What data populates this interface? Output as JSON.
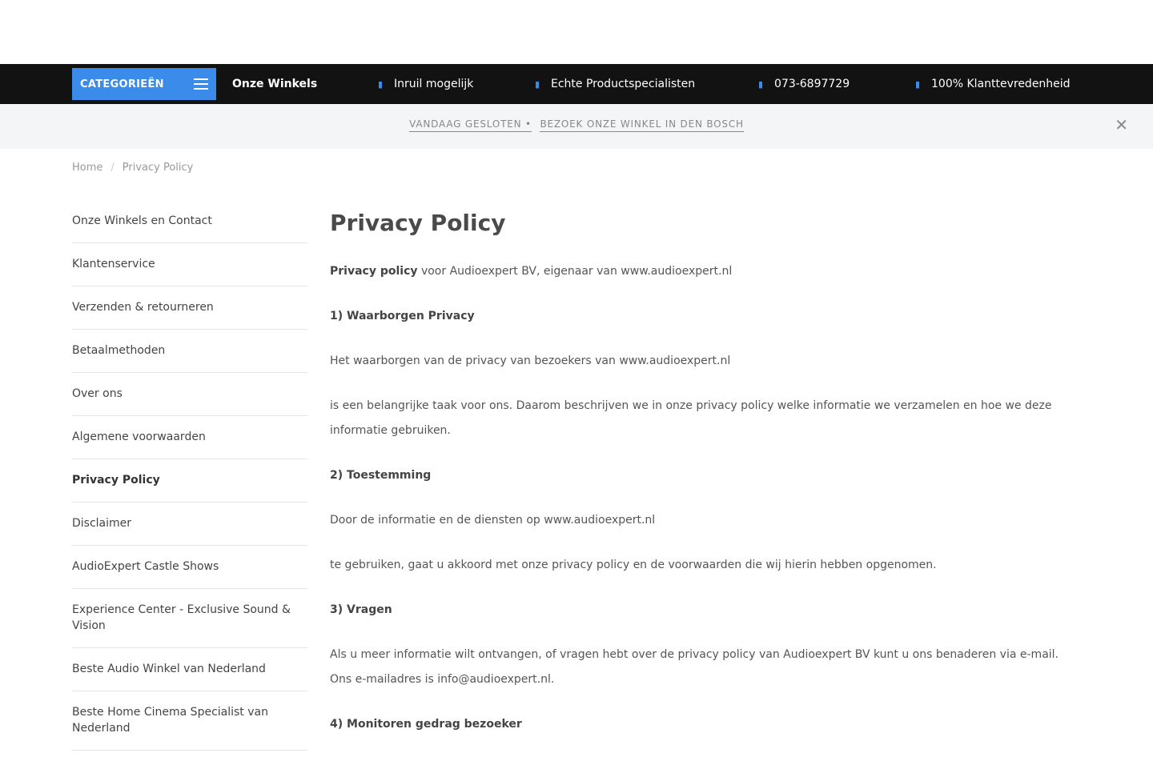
{
  "navbar": {
    "categories_label": "CATEGORIEËN",
    "stores_link": "Onze Winkels",
    "usps": [
      {
        "icon": "check-icon",
        "label": "Inruil mogelijk"
      },
      {
        "icon": "check-icon",
        "label": "Echte Productspecialisten"
      },
      {
        "icon": "phone-icon",
        "label": "073-6897729"
      },
      {
        "icon": "check-icon",
        "label": "100% Klanttevredenheid"
      }
    ],
    "accent_color": "#3b8bea"
  },
  "notice": {
    "part1": "VANDAAG GESLOTEN •",
    "part2": "BEZOEK ONZE WINKEL IN DEN BOSCH",
    "close_glyph": "✕"
  },
  "breadcrumb": {
    "home": "Home",
    "separator": "/",
    "current": "Privacy Policy"
  },
  "sidebar": {
    "items": [
      {
        "label": "Onze Winkels en Contact",
        "active": false
      },
      {
        "label": "Klantenservice",
        "active": false
      },
      {
        "label": "Verzenden & retourneren",
        "active": false
      },
      {
        "label": "Betaalmethoden",
        "active": false
      },
      {
        "label": "Over ons",
        "active": false
      },
      {
        "label": "Algemene voorwaarden",
        "active": false
      },
      {
        "label": "Privacy Policy",
        "active": true
      },
      {
        "label": "Disclaimer",
        "active": false
      },
      {
        "label": "AudioExpert Castle Shows",
        "active": false
      },
      {
        "label": "Experience Center - Exclusive Sound & Vision",
        "active": false
      },
      {
        "label": "Beste Audio Winkel van Nederland",
        "active": false
      },
      {
        "label": "Beste Home Cinema Specialist van Nederland",
        "active": false
      }
    ]
  },
  "content": {
    "title": "Privacy Policy",
    "intro_bold": "Privacy policy",
    "intro_rest": " voor Audioexpert BV, eigenaar van www.audioexpert.nl",
    "h1": "1) Waarborgen Privacy",
    "p1": "Het waarborgen van de privacy van bezoekers van www.audioexpert.nl",
    "p2": "is een belangrijke taak voor ons. Daarom beschrijven we in onze privacy policy welke informatie we verzamelen en hoe we deze informatie gebruiken.",
    "h2": "2) Toestemming",
    "p3": "Door de informatie en de diensten op www.audioexpert.nl",
    "p4": "te gebruiken, gaat u akkoord met onze privacy policy en de voorwaarden die wij hierin hebben opgenomen.",
    "h3": "3) Vragen",
    "p5": "Als u meer informatie wilt ontvangen, of vragen hebt over de privacy policy van Audioexpert BV kunt u ons benaderen via e-mail. Ons e-mailadres is info@audioexpert.nl.",
    "h4": "4) Monitoren gedrag bezoeker"
  }
}
